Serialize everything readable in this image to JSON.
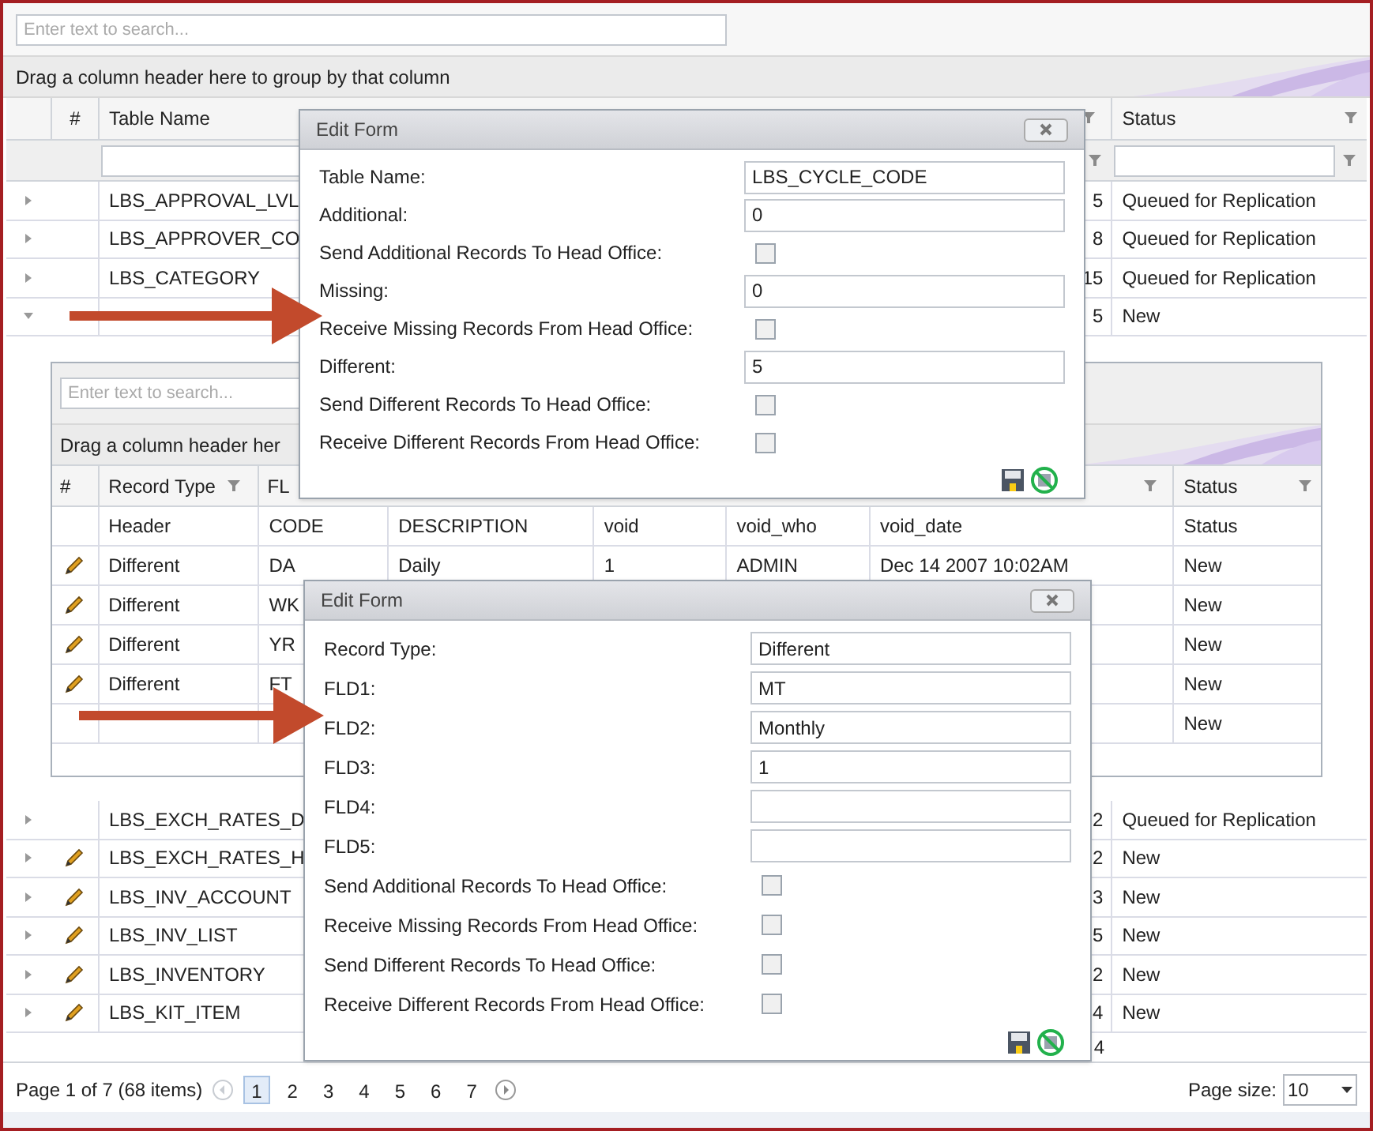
{
  "main_grid": {
    "search_placeholder": "Enter text to search...",
    "group_panel_text": "Drag a column header here to group by that column",
    "header": {
      "number": "#",
      "table_name": "Table Name",
      "status": "Status"
    },
    "rows": [
      {
        "expanded": false,
        "editable": false,
        "table_name": "LBS_APPROVAL_LVL",
        "count": "5",
        "status": "Queued for Replication"
      },
      {
        "expanded": false,
        "editable": false,
        "table_name": "LBS_APPROVER_CO",
        "count": "8",
        "status": "Queued for Replication"
      },
      {
        "expanded": false,
        "editable": false,
        "table_name": "LBS_CATEGORY",
        "count": "15",
        "status": "Queued for Replication"
      },
      {
        "expanded": true,
        "editable": false,
        "count": "5",
        "status": "New"
      },
      {
        "expanded": false,
        "editable": false,
        "table_name": "LBS_EXCH_RATES_D",
        "count": "2",
        "status": "Queued for Replication"
      },
      {
        "expanded": false,
        "editable": true,
        "table_name": "LBS_EXCH_RATES_H",
        "count": "2",
        "status": "New"
      },
      {
        "expanded": false,
        "editable": true,
        "table_name": "LBS_INV_ACCOUNT",
        "count": "3",
        "status": "New"
      },
      {
        "expanded": false,
        "editable": true,
        "table_name": "LBS_INV_LIST",
        "count": "5",
        "status": "New"
      },
      {
        "expanded": false,
        "editable": true,
        "table_name": "LBS_INVENTORY",
        "count": "2",
        "status": "New"
      },
      {
        "expanded": false,
        "editable": true,
        "table_name": "LBS_KIT_ITEM",
        "count": "4",
        "status": "New"
      }
    ],
    "summary_count": "4"
  },
  "detail_grid": {
    "search_placeholder": "Enter text to search...",
    "group_panel_text": "Drag a column header her",
    "header": {
      "number": "#",
      "record_type": "Record Type",
      "fld1": "FL",
      "status": "Status"
    },
    "rows": [
      {
        "editable": false,
        "record_type": "Header",
        "fld1": "CODE",
        "fld2": "DESCRIPTION",
        "fld3": "void",
        "fld4": "void_who",
        "fld5": "void_date",
        "status": "Status"
      },
      {
        "editable": true,
        "record_type": "Different",
        "fld1": "DA",
        "fld2": "Daily",
        "fld3": "1",
        "fld4": "ADMIN",
        "fld5": "Dec 14 2007 10:02AM",
        "status": "New"
      },
      {
        "editable": true,
        "record_type": "Different",
        "fld1": "WK",
        "status": "New"
      },
      {
        "editable": true,
        "record_type": "Different",
        "fld1": "YR",
        "status": "New"
      },
      {
        "editable": true,
        "record_type": "Different",
        "fld1": "FT",
        "status": "New"
      },
      {
        "editable": false,
        "status": "New"
      }
    ]
  },
  "dialogs": [
    {
      "title": "Edit Form",
      "fields": [
        {
          "kind": "text",
          "label": "Table Name:",
          "value": "LBS_CYCLE_CODE"
        },
        {
          "kind": "text",
          "label": "Additional:",
          "value": "0"
        },
        {
          "kind": "checkbox",
          "label": "Send Additional Records To Head Office:",
          "checked": false
        },
        {
          "kind": "text",
          "label": "Missing:",
          "value": "0"
        },
        {
          "kind": "checkbox",
          "label": "Receive Missing Records From Head Office:",
          "checked": false
        },
        {
          "kind": "text",
          "label": "Different:",
          "value": "5"
        },
        {
          "kind": "checkbox",
          "label": "Send Different Records To Head Office:",
          "checked": false
        },
        {
          "kind": "checkbox",
          "label": "Receive Different Records From Head Office:",
          "checked": false
        }
      ]
    },
    {
      "title": "Edit Form",
      "fields": [
        {
          "kind": "text",
          "label": "Record Type:",
          "value": "Different"
        },
        {
          "kind": "text",
          "label": "FLD1:",
          "value": "MT"
        },
        {
          "kind": "text",
          "label": "FLD2:",
          "value": "Monthly"
        },
        {
          "kind": "text",
          "label": "FLD3:",
          "value": "1"
        },
        {
          "kind": "text",
          "label": "FLD4:"
        },
        {
          "kind": "text",
          "label": "FLD5:"
        },
        {
          "kind": "checkbox",
          "label": "Send Additional Records To Head Office:",
          "checked": false
        },
        {
          "kind": "checkbox",
          "label": "Receive Missing Records From Head Office:",
          "checked": false
        },
        {
          "kind": "checkbox",
          "label": "Send Different Records To Head Office:",
          "checked": false
        },
        {
          "kind": "checkbox",
          "label": "Receive Different Records From Head Office:",
          "checked": false
        }
      ]
    }
  ],
  "pager": {
    "summary": "Page 1 of 7 (68 items)",
    "pages": [
      {
        "label": "1",
        "selected": true
      },
      {
        "label": "2",
        "selected": false
      },
      {
        "label": "3",
        "selected": false
      },
      {
        "label": "4",
        "selected": false
      },
      {
        "label": "5",
        "selected": false
      },
      {
        "label": "6",
        "selected": false
      },
      {
        "label": "7",
        "selected": false
      }
    ],
    "page_size_label": "Page size:",
    "page_size": "10"
  }
}
